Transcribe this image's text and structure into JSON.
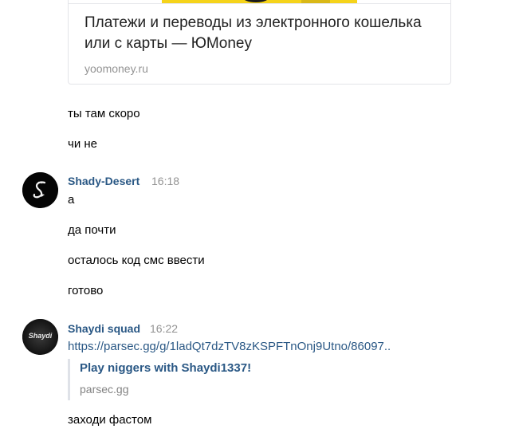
{
  "preview_card": {
    "title": "Платежи и переводы из электронного кошелька или с карты — ЮMoney",
    "domain": "yoomoney.ru"
  },
  "messages_group1": [
    {
      "text": "ты там скоро"
    },
    {
      "text": "чи не"
    }
  ],
  "group2": {
    "author": "Shady-Desert",
    "time": "16:18",
    "messages": [
      {
        "text": "а"
      },
      {
        "text": "да почти"
      },
      {
        "text": "осталось код смс ввести"
      },
      {
        "text": "готово"
      }
    ]
  },
  "group3": {
    "author": "Shaydi squad",
    "time": "16:22",
    "avatar_text": "Shaydi",
    "link": "https://parsec.gg/g/1ladQt7dzTV8zKSPFTnOnj9Utno/86097..",
    "snippet": {
      "title": "Play niggers with Shaydi1337!",
      "domain": "parsec.gg"
    },
    "last_message": "заходи фастом"
  },
  "colors": {
    "author": "#2a5885",
    "time": "#939393",
    "link": "#2a5885"
  }
}
